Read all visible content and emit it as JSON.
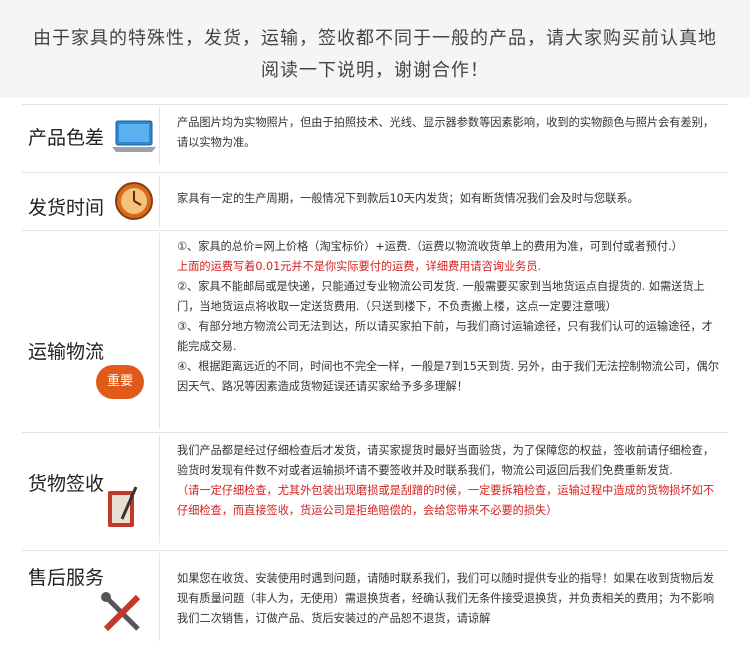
{
  "header": {
    "line1": "由于家具的特殊性，发货，运输，签收都不同于一般的产品，请大家购买前认真地",
    "line2": "阅读一下说明，谢谢合作！"
  },
  "sections": {
    "color": {
      "title": "产品色差",
      "text": "产品图片均为实物照片，但由于拍照技术、光线、显示器参数等因素影响，收到的实物颜色与照片会有差别，请以实物为准。"
    },
    "shipping": {
      "title": "发货时间",
      "text": "家具有一定的生产周期，一般情况下到款后10天内发货；如有断货情况我们会及时与您联系。"
    },
    "transport": {
      "title": "运输物流",
      "badge": "重要",
      "p1": "①、家具的总价=网上价格（淘宝标价）+运费.（运费以物流收货单上的费用为准，可到付或者预付.）",
      "p1_red": "上面的运费写着0.01元并不是你实际要付的运费，详细费用请咨询业务员.",
      "p2": "②、家具不能邮局或是快递，只能通过专业物流公司发货. 一般需要买家到当地货运点自提货的. 如需送货上门，当地货运点将收取一定送货费用.（只送到楼下，不负责搬上楼，这点一定要注意哦）",
      "p3": "③、有部分地方物流公司无法到达，所以请买家拍下前，与我们商讨运输途径，只有我们认可的运输途径，才能完成交易.",
      "p4": "④、根据距离远近的不同，时间也不完全一样，一般是7到15天到货. 另外，由于我们无法控制物流公司，偶尔因天气、路况等因素造成货物延误还请买家给予多多理解！"
    },
    "receipt": {
      "title": "货物签收",
      "text": "我们产品都是经过仔细检查后才发货，请买家提货时最好当面验货，为了保障您的权益，签收前请仔细检查，验货时发现有件数不对或者运输损坏请不要签收并及时联系我们，物流公司返回后我们免费重新发货.",
      "red": "（请一定仔细检查，尤其外包装出现磨损或是刮蹭的时候，一定要拆箱检查，运输过程中造成的货物损坏如不仔细检查，而直接签收，货运公司是拒绝赔偿的，会给您带来不必要的损失）"
    },
    "after": {
      "title": "售后服务",
      "text": "如果您在收货、安装使用时遇到问题，请随时联系我们，我们可以随时提供专业的指导！如果在收到货物后发现有质量问题（非人为，无使用）需退换货者，经确认我们无条件接受退换货，并负责相关的费用；为不影响我们二次销售，订做产品、货后安装过的产品恕不退货，请谅解"
    }
  },
  "icons": {
    "color": "laptop-icon",
    "shipping": "clock-icon",
    "receipt": "pen-icon",
    "after": "tools-icon"
  },
  "colors": {
    "accent_red": "#d42020",
    "badge": "#e25a1a"
  }
}
